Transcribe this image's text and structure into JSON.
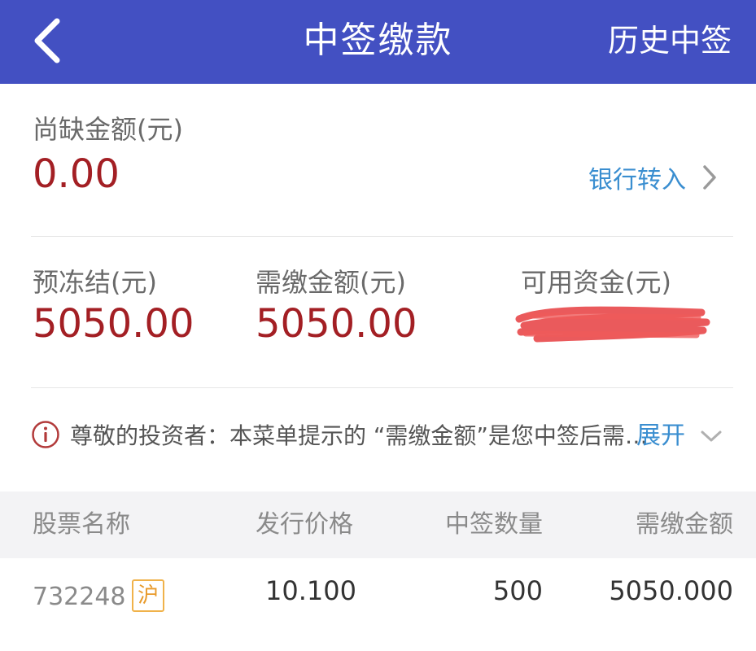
{
  "header": {
    "title": "中签缴款",
    "history_link": "历史中签",
    "background_color": "#4350c2",
    "back_icon": "chevron-left-icon"
  },
  "shortfall": {
    "label": "尚缺金额(元)",
    "value": "0.00",
    "bank_transfer_label": "银行转入",
    "bank_transfer_icon": "chevron-right-icon"
  },
  "summary": {
    "frozen_label": "预冻结(元)",
    "frozen_value": "5050.00",
    "payable_label": "需缴金额(元)",
    "payable_value": "5050.00",
    "available_label": "可用资金(元)",
    "available_value_redacted": true
  },
  "notice": {
    "icon": "info-icon",
    "text": "尊敬的投资者：本菜单提示的 “需缴金额”是您中签后需缴纳的金额",
    "expand_label": "展开",
    "expand_icon": "chevron-down-icon"
  },
  "table": {
    "columns": [
      "股票名称",
      "发行价格",
      "中签数量",
      "需缴金额"
    ],
    "rows": [
      {
        "code": "732248",
        "market": "沪",
        "price": "10.100",
        "quantity": "500",
        "amount": "5050.000"
      }
    ]
  },
  "colors": {
    "accent_red": "#a31f24",
    "link_blue": "#3a8ed0",
    "market_badge": "#e89a2a"
  }
}
